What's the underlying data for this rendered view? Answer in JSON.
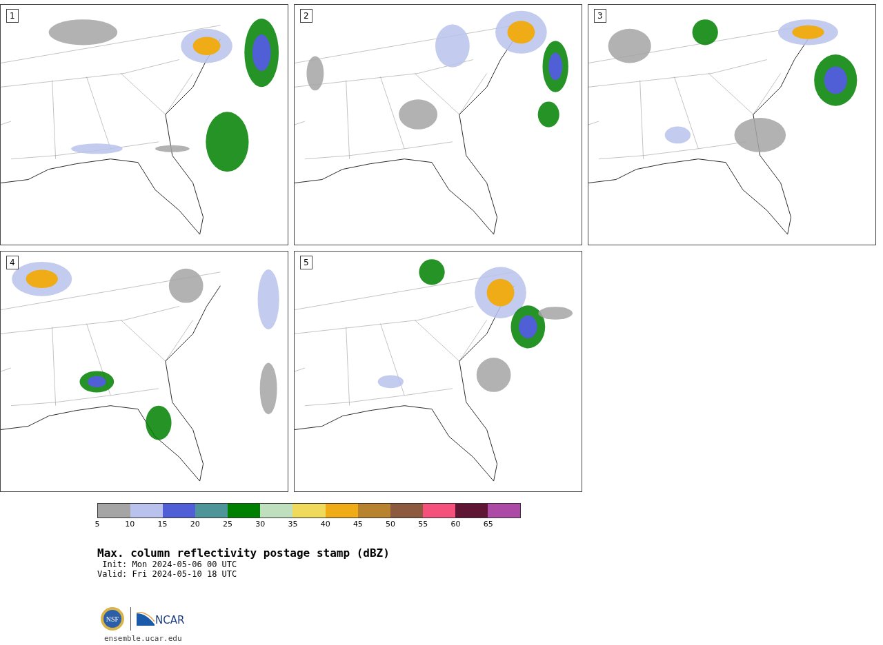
{
  "panels": [
    {
      "label": "1"
    },
    {
      "label": "2"
    },
    {
      "label": "3"
    },
    {
      "label": "4"
    },
    {
      "label": "5"
    }
  ],
  "colorbar": {
    "segments": [
      {
        "color": "#a5a5a5"
      },
      {
        "color": "#b8c2ec"
      },
      {
        "color": "#505fd6"
      },
      {
        "color": "#4e9599"
      },
      {
        "color": "#008000"
      },
      {
        "color": "#bfdfbf"
      },
      {
        "color": "#f0da5c"
      },
      {
        "color": "#efac17"
      },
      {
        "color": "#b8832f"
      },
      {
        "color": "#8b5a3f"
      },
      {
        "color": "#f4527c"
      },
      {
        "color": "#5e1634"
      },
      {
        "color": "#ac4ba5"
      }
    ],
    "ticks": [
      "5",
      "10",
      "15",
      "20",
      "25",
      "30",
      "35",
      "40",
      "45",
      "50",
      "55",
      "60",
      "65"
    ]
  },
  "title": "Max. column reflectivity postage stamp (dBZ)",
  "init": " Init: Mon 2024-05-06 00 UTC",
  "valid": "Valid: Fri 2024-05-10 18 UTC",
  "logos": {
    "nsf": "NSF",
    "ncar": "NCAR"
  },
  "url": "ensemble.ucar.edu"
}
